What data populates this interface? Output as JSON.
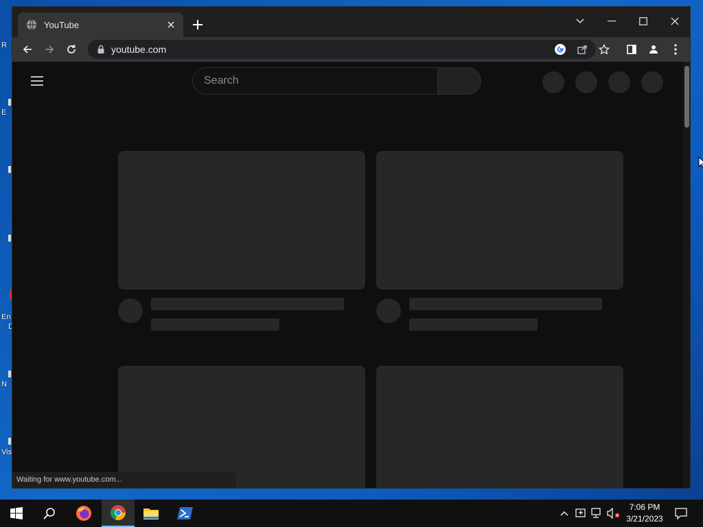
{
  "desktop": {
    "icon_labels": [
      "R",
      "E",
      "En",
      "D",
      "N",
      "Vis"
    ]
  },
  "browser": {
    "tab": {
      "title": "YouTube"
    },
    "address": {
      "url": "youtube.com"
    },
    "status_text": "Waiting for www.youtube.com..."
  },
  "youtube": {
    "search_placeholder": "Search"
  },
  "taskbar": {
    "time": "7:06 PM",
    "date": "3/21/2023"
  },
  "colors": {
    "page_bg": "#0f0f0f",
    "skeleton": "#272727",
    "chrome_toolbar": "#353535",
    "taskbar": "#101010"
  }
}
